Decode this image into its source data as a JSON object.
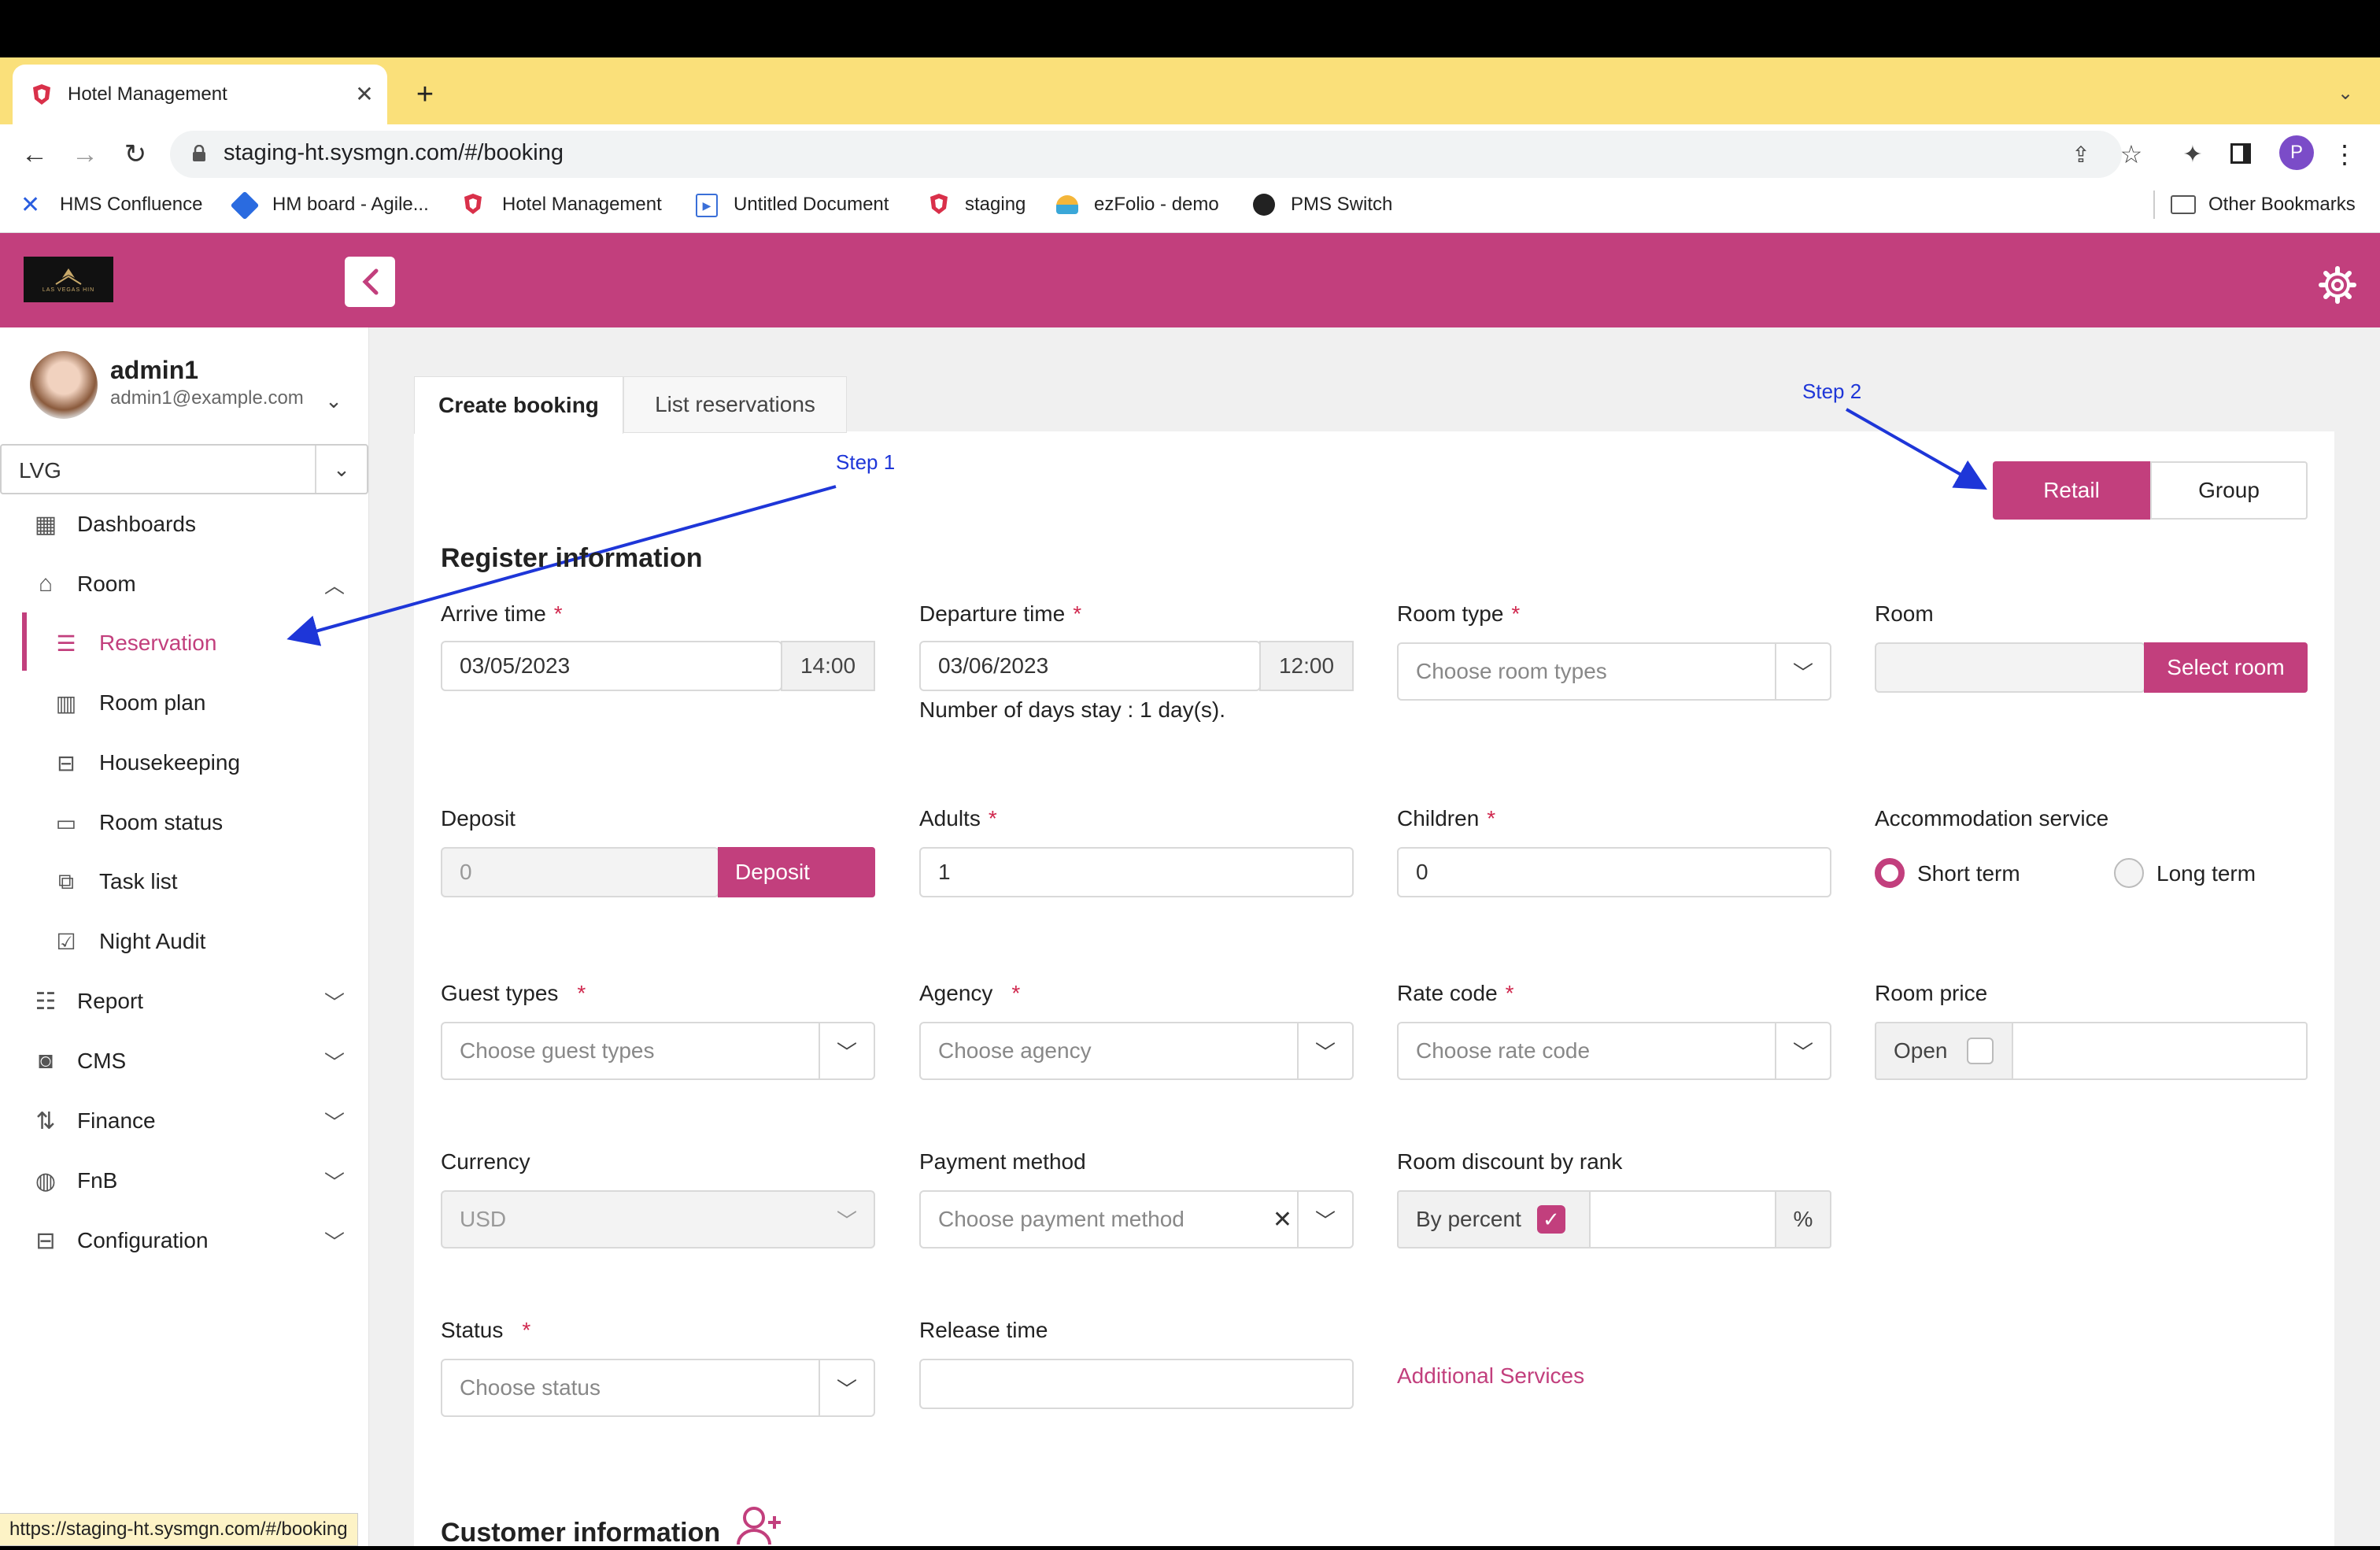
{
  "browser": {
    "tab_title": "Hotel Management",
    "url": "staging-ht.sysmgn.com/#/booking",
    "status_url": "https://staging-ht.sysmgn.com/#/booking",
    "profile_initial": "P",
    "bookmarks": [
      "HMS Confluence",
      "HM board - Agile...",
      "Hotel Management",
      "Untitled Document",
      "staging",
      "ezFolio - demo",
      "PMS Switch"
    ],
    "other_bookmarks": "Other Bookmarks"
  },
  "header": {
    "logo_text": "LAS VEGAS HIN"
  },
  "user": {
    "name": "admin1",
    "email": "admin1@example.com"
  },
  "hotel_select": "LVG",
  "nav": {
    "dashboards": "Dashboards",
    "room": "Room",
    "room_sub": [
      "Reservation",
      "Room plan",
      "Housekeeping",
      "Room status",
      "Task list",
      "Night Audit"
    ],
    "report": "Report",
    "cms": "CMS",
    "finance": "Finance",
    "fnb": "FnB",
    "configuration": "Configuration"
  },
  "tabs": {
    "create": "Create booking",
    "list": "List reservations"
  },
  "annotations": {
    "step1": "Step 1",
    "step2": "Step 2"
  },
  "mode": {
    "retail": "Retail",
    "group": "Group"
  },
  "form": {
    "section_title": "Register information",
    "arrive_label": "Arrive time",
    "arrive_date": "03/05/2023",
    "arrive_time": "14:00",
    "departure_label": "Departure time",
    "departure_date": "03/06/2023",
    "departure_time": "12:00",
    "days_stay": "Number of days stay : 1 day(s).",
    "room_type_label": "Room type",
    "room_type_ph": "Choose room types",
    "room_label": "Room",
    "select_room": "Select room",
    "deposit_label": "Deposit",
    "deposit_value": "0",
    "deposit_btn": "Deposit",
    "adults_label": "Adults",
    "adults_value": "1",
    "children_label": "Children",
    "children_value": "0",
    "accommodation_label": "Accommodation service",
    "short_term": "Short term",
    "long_term": "Long term",
    "guest_types_label": "Guest types",
    "guest_types_ph": "Choose guest types",
    "agency_label": "Agency",
    "agency_ph": "Choose agency",
    "rate_code_label": "Rate code",
    "rate_code_ph": "Choose rate code",
    "room_price_label": "Room price",
    "open_label": "Open",
    "currency_label": "Currency",
    "currency_value": "USD",
    "payment_label": "Payment method",
    "payment_ph": "Choose payment method",
    "discount_label": "Room discount by rank",
    "by_percent": "By percent",
    "percent_sign": "%",
    "status_label": "Status",
    "status_ph": "Choose status",
    "release_label": "Release time",
    "additional_services": "Additional Services",
    "customer_title": "Customer information"
  },
  "colors": {
    "brand": "#c23f7d",
    "annotation": "#1e36d8",
    "tabbar": "#fae07a"
  }
}
